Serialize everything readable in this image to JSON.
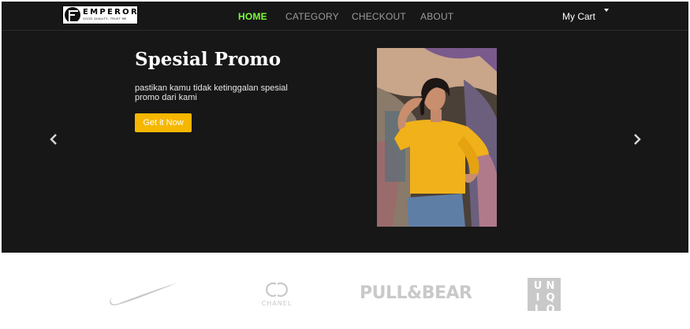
{
  "brand": {
    "logo_name": "EMPEROR",
    "logo_tagline": "GOOD QUALITY, TRUST ME"
  },
  "nav": {
    "items": [
      {
        "label": "HOME",
        "active": true
      },
      {
        "label": "CATEGORY",
        "active": false
      },
      {
        "label": "CHECKOUT",
        "active": false
      },
      {
        "label": "ABOUT",
        "active": false
      }
    ],
    "cart_label": "My Cart"
  },
  "hero": {
    "title": "Spesial Promo",
    "description": "pastikan kamu tidak ketinggalan spesial promo dari kami",
    "cta_label": "Get it Now"
  },
  "brands": {
    "chanel_word": "CHANEL",
    "pullbear": "PULL&BEAR",
    "uniqlo_letters": [
      "U",
      "N",
      "I",
      "Q",
      "L",
      "O"
    ]
  },
  "colors": {
    "background": "#171717",
    "nav_active": "#7cfc3b",
    "nav_inactive": "#9b9b9b",
    "cta": "#f5b700",
    "brand_gray": "#c9c9c9"
  },
  "icons": {
    "prev": "chevron-left-icon",
    "next": "chevron-right-icon",
    "cart_caret": "caret-down-icon"
  }
}
